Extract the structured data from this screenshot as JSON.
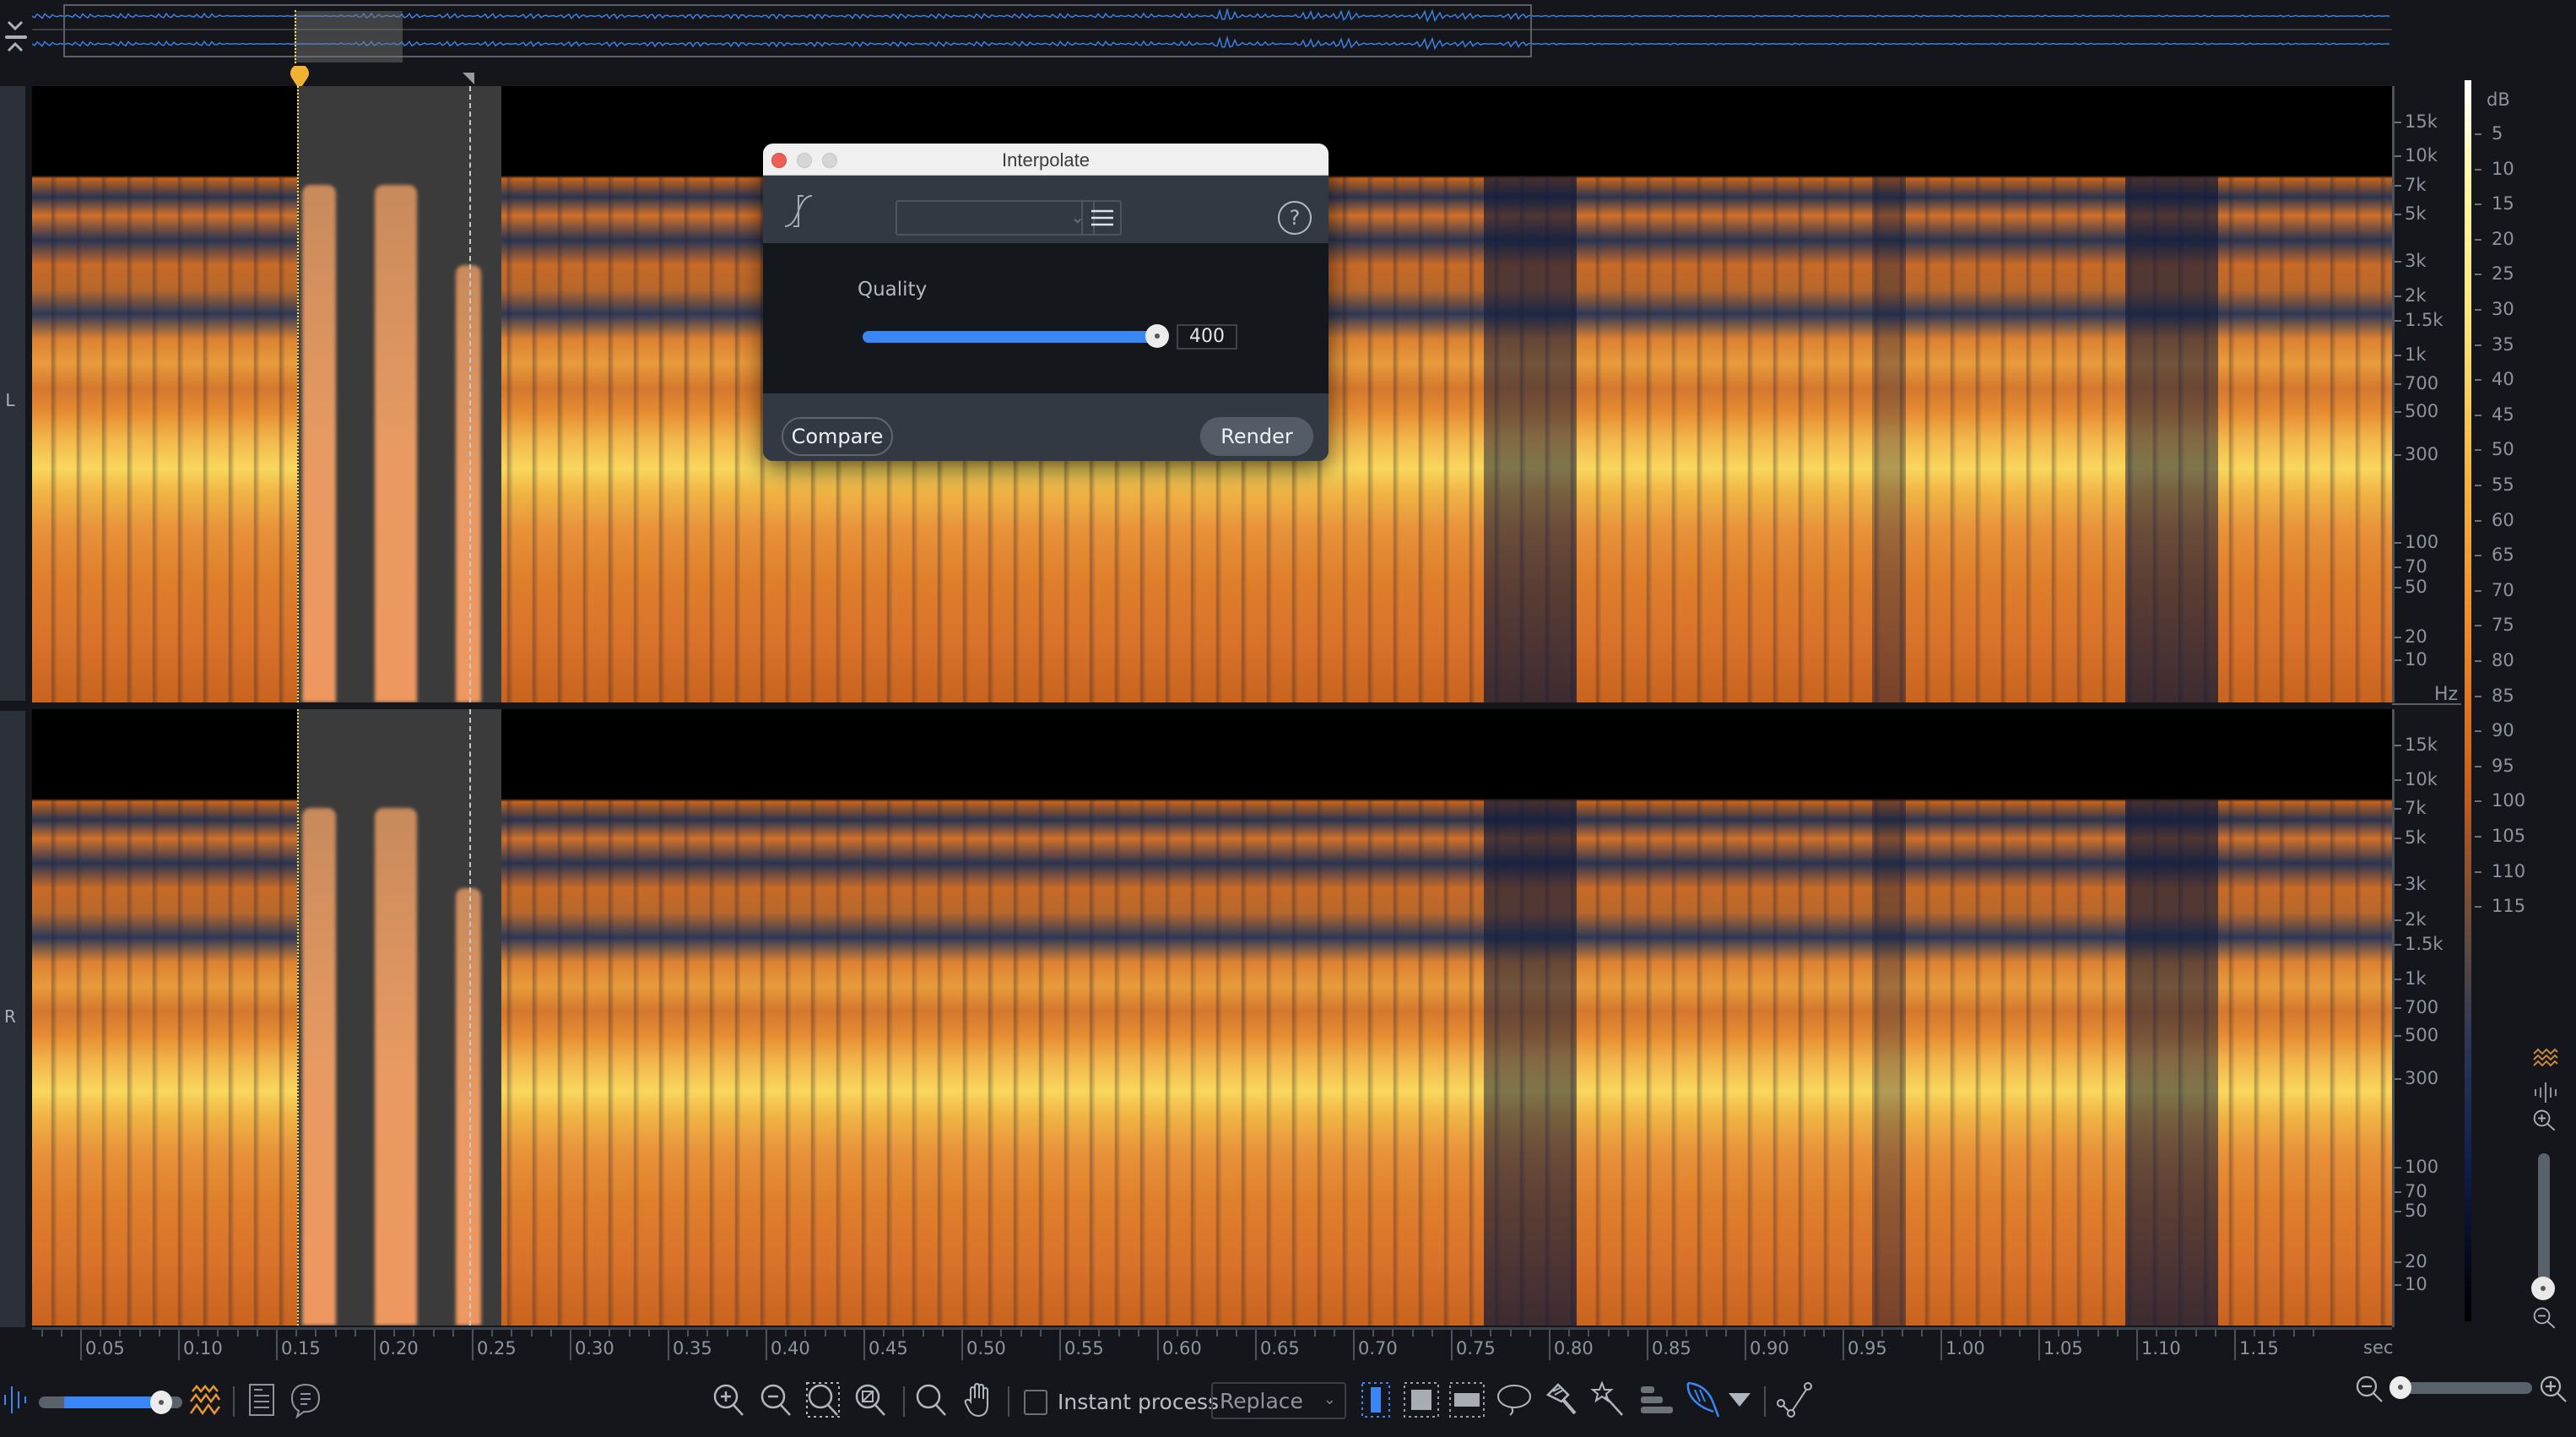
{
  "overview": {
    "collapse_icons": [
      "chevron-down-icon",
      "chevron-up-icon"
    ]
  },
  "channels": [
    {
      "label": "L"
    },
    {
      "label": "R"
    }
  ],
  "freq_axis": {
    "unit": "Hz",
    "ticks": [
      "15k",
      "10k",
      "7k",
      "5k",
      "3k",
      "2k",
      "1.5k",
      "1k",
      "700",
      "500",
      "300",
      "100",
      "70",
      "50",
      "20",
      "10"
    ]
  },
  "db_scale": {
    "title": "dB",
    "ticks": [
      "5",
      "10",
      "15",
      "20",
      "25",
      "30",
      "35",
      "40",
      "45",
      "50",
      "55",
      "60",
      "65",
      "70",
      "75",
      "80",
      "85",
      "90",
      "95",
      "100",
      "105",
      "110",
      "115"
    ]
  },
  "time_ruler": {
    "unit": "sec",
    "ticks": [
      "0.05",
      "0.10",
      "0.15",
      "0.20",
      "0.25",
      "0.30",
      "0.35",
      "0.40",
      "0.45",
      "0.50",
      "0.55",
      "0.60",
      "0.65",
      "0.70",
      "0.75",
      "0.80",
      "0.85",
      "0.90",
      "0.95",
      "1.00",
      "1.05",
      "1.10",
      "1.15"
    ]
  },
  "selection": {
    "start_sec": 0.15,
    "end_sec": 0.24
  },
  "dialog": {
    "title": "Interpolate",
    "preset_value": "",
    "quality_label": "Quality",
    "quality_value": "400",
    "quality_fraction": 1.0,
    "compare_label": "Compare",
    "render_label": "Render"
  },
  "toolbar": {
    "waveform_spectrogram_mix_fraction": 0.85,
    "instant_process_label": "Instant process",
    "instant_process_checked": false,
    "replace_mode": "Replace",
    "horizontal_zoom_fraction": 0.0
  },
  "colors": {
    "accent_blue": "#3a86f5",
    "cursor_yellow": "#f3e15a",
    "marker_orange": "#f0b232",
    "background": "#14161b"
  }
}
